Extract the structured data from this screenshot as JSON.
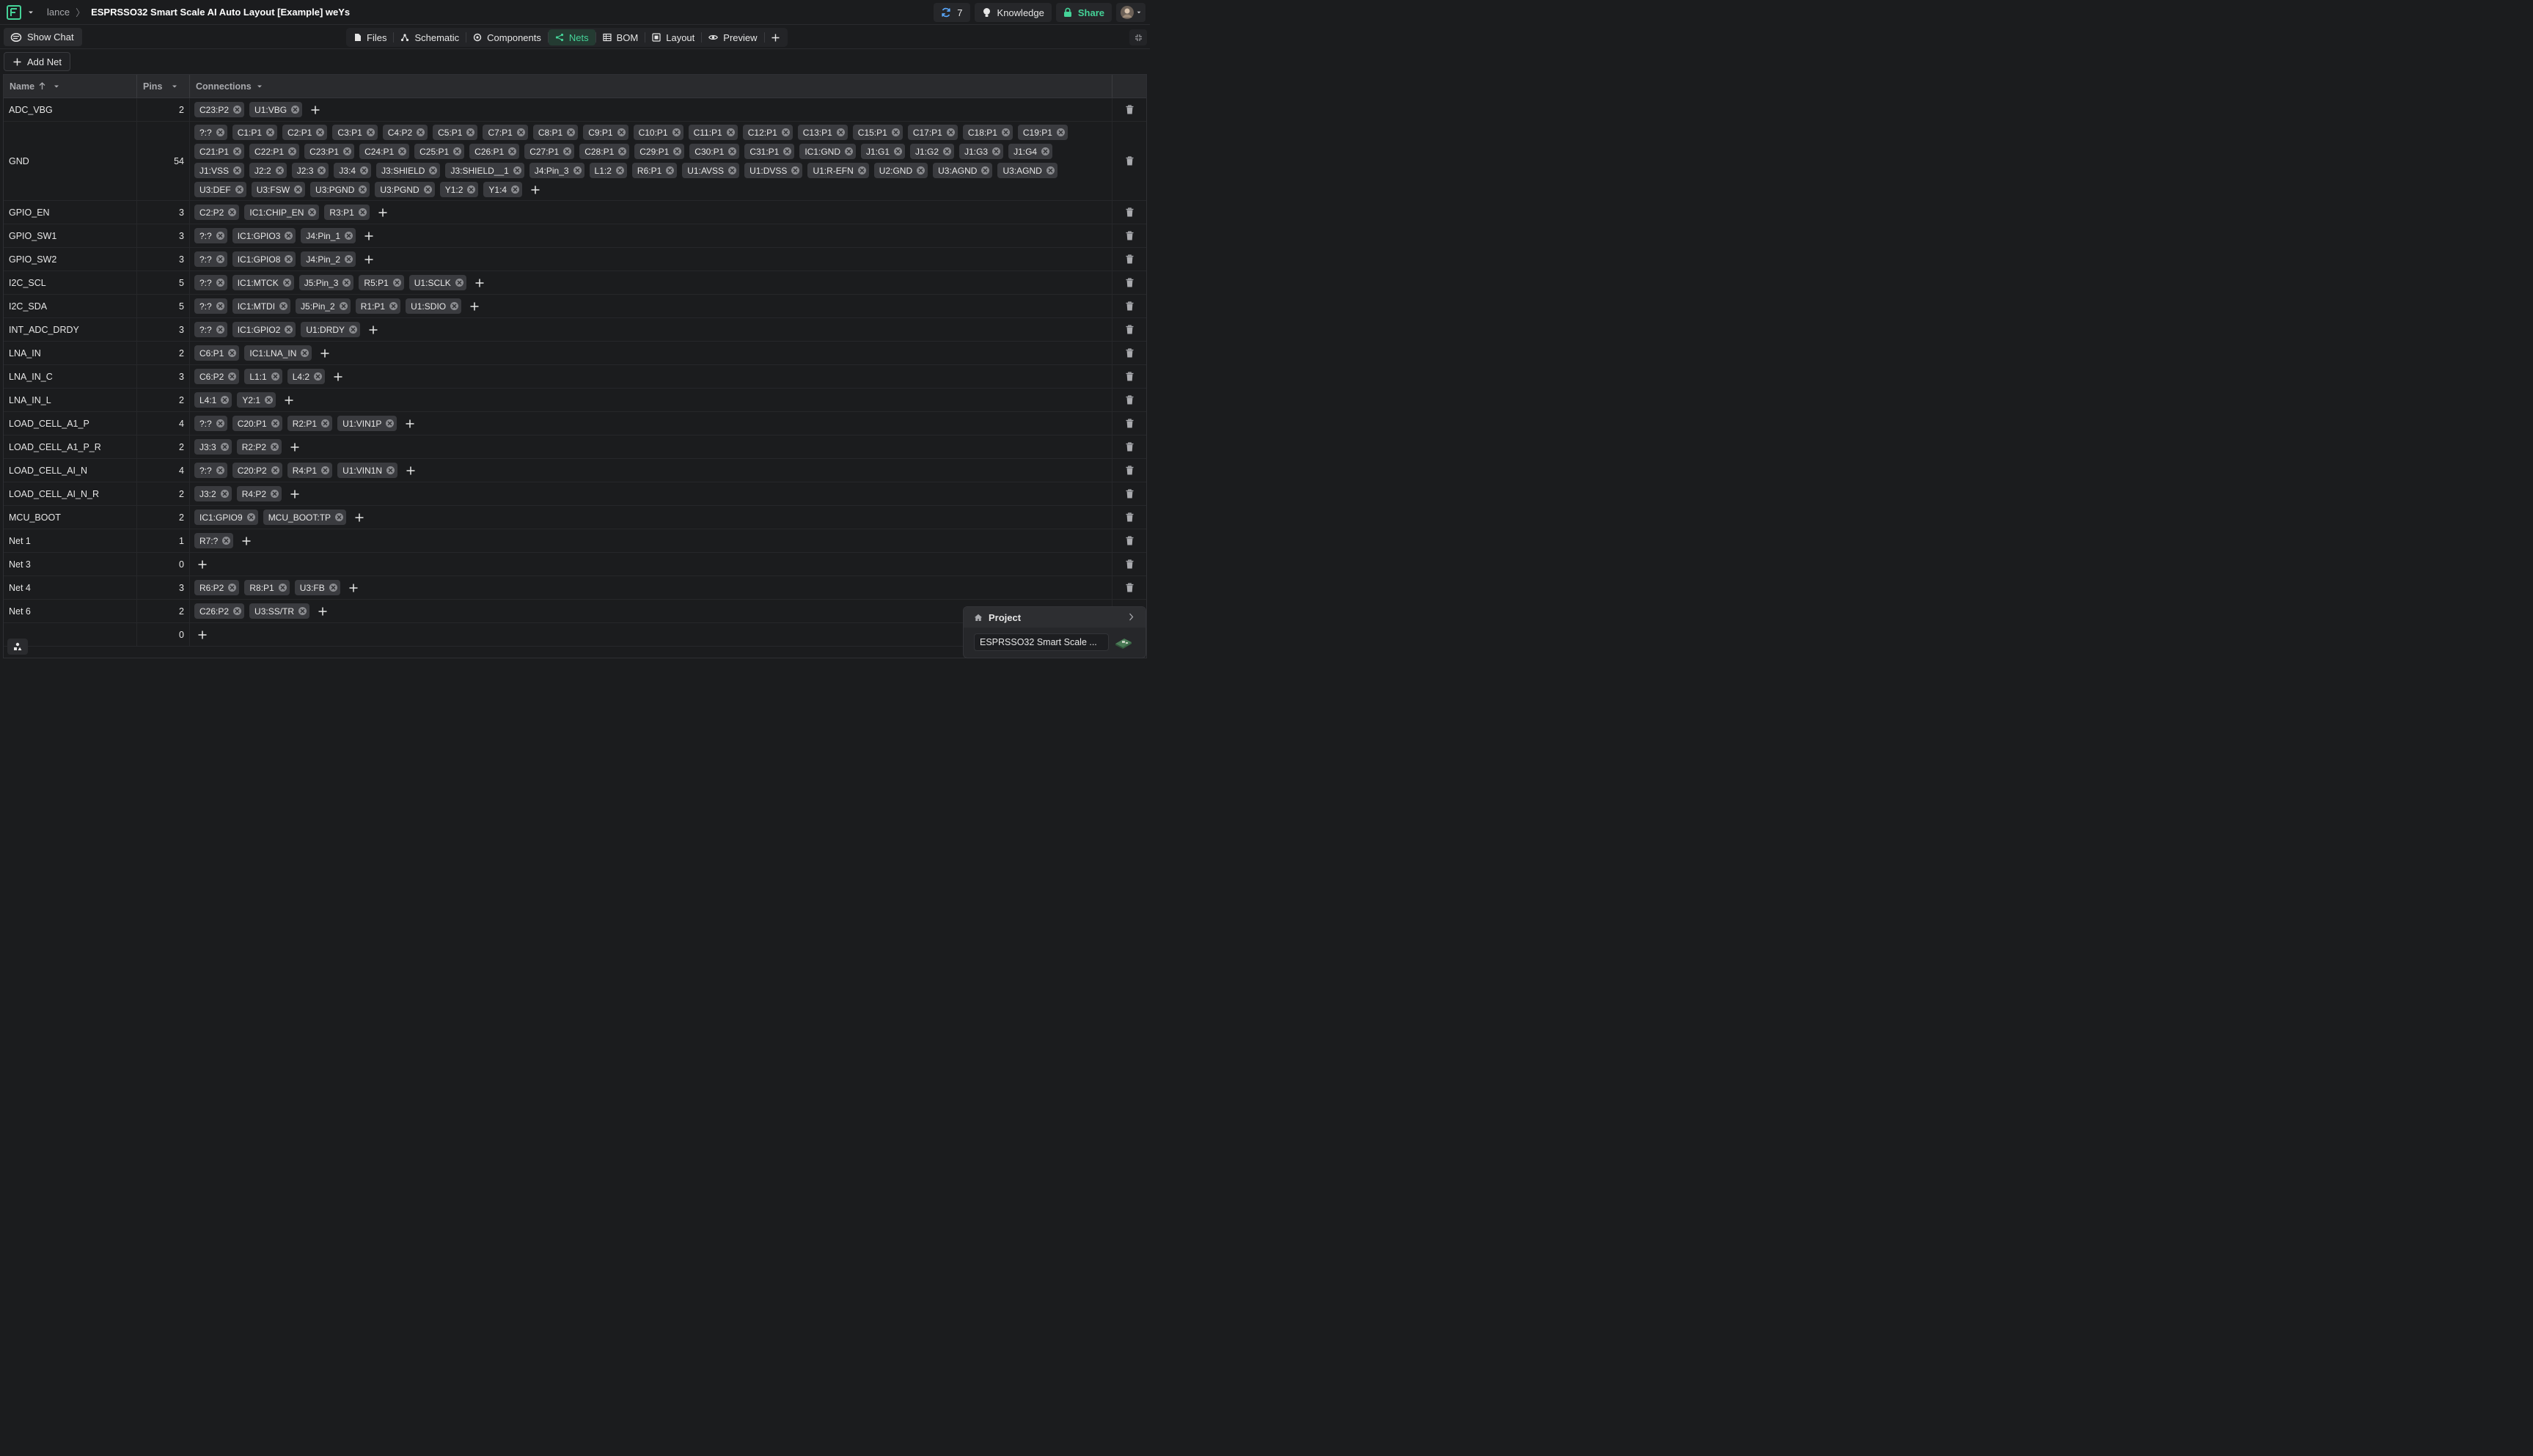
{
  "topbar": {
    "user": "lance",
    "separator": "〉",
    "title": "ESPRSSO32 Smart Scale AI Auto Layout [Example] weYs",
    "sync_count": "7",
    "knowledge_label": "Knowledge",
    "share_label": "Share"
  },
  "toolbar": {
    "show_chat_label": "Show Chat",
    "tabs": [
      {
        "label": "Files",
        "icon": "file-icon"
      },
      {
        "label": "Schematic",
        "icon": "schematic-icon"
      },
      {
        "label": "Components",
        "icon": "components-icon"
      },
      {
        "label": "Nets",
        "icon": "nets-icon"
      },
      {
        "label": "BOM",
        "icon": "bom-icon"
      },
      {
        "label": "Layout",
        "icon": "layout-icon"
      },
      {
        "label": "Preview",
        "icon": "eye-icon"
      }
    ],
    "active_tab": "Nets",
    "accent": "#45d398"
  },
  "add_net_label": "Add Net",
  "table": {
    "headers": {
      "name": "Name",
      "pins": "Pins",
      "connections": "Connections"
    },
    "rows": [
      {
        "name": "ADC_VBG",
        "pins": "2",
        "connections": [
          "C23:P2",
          "U1:VBG"
        ]
      },
      {
        "name": "GND",
        "pins": "54",
        "connections": [
          "?:?",
          "C1:P1",
          "C2:P1",
          "C3:P1",
          "C4:P2",
          "C5:P1",
          "C7:P1",
          "C8:P1",
          "C9:P1",
          "C10:P1",
          "C11:P1",
          "C12:P1",
          "C13:P1",
          "C15:P1",
          "C17:P1",
          "C18:P1",
          "C19:P1",
          "C21:P1",
          "C22:P1",
          "C23:P1",
          "C24:P1",
          "C25:P1",
          "C26:P1",
          "C27:P1",
          "C28:P1",
          "C29:P1",
          "C30:P1",
          "C31:P1",
          "IC1:GND",
          "J1:G1",
          "J1:G2",
          "J1:G3",
          "J1:G4",
          "J1:VSS",
          "J2:2",
          "J2:3",
          "J3:4",
          "J3:SHIELD",
          "J3:SHIELD__1",
          "J4:Pin_3",
          "L1:2",
          "R6:P1",
          "U1:AVSS",
          "U1:DVSS",
          "U1:R-EFN",
          "U2:GND",
          "U3:AGND",
          "U3:AGND",
          "U3:DEF",
          "U3:FSW",
          "U3:PGND",
          "U3:PGND",
          "Y1:2",
          "Y1:4"
        ]
      },
      {
        "name": "GPIO_EN",
        "pins": "3",
        "connections": [
          "C2:P2",
          "IC1:CHIP_EN",
          "R3:P1"
        ]
      },
      {
        "name": "GPIO_SW1",
        "pins": "3",
        "connections": [
          "?:?",
          "IC1:GPIO3",
          "J4:Pin_1"
        ]
      },
      {
        "name": "GPIO_SW2",
        "pins": "3",
        "connections": [
          "?:?",
          "IC1:GPIO8",
          "J4:Pin_2"
        ]
      },
      {
        "name": "I2C_SCL",
        "pins": "5",
        "connections": [
          "?:?",
          "IC1:MTCK",
          "J5:Pin_3",
          "R5:P1",
          "U1:SCLK"
        ]
      },
      {
        "name": "I2C_SDA",
        "pins": "5",
        "connections": [
          "?:?",
          "IC1:MTDI",
          "J5:Pin_2",
          "R1:P1",
          "U1:SDIO"
        ]
      },
      {
        "name": "INT_ADC_DRDY",
        "pins": "3",
        "connections": [
          "?:?",
          "IC1:GPIO2",
          "U1:DRDY"
        ]
      },
      {
        "name": "LNA_IN",
        "pins": "2",
        "connections": [
          "C6:P1",
          "IC1:LNA_IN"
        ]
      },
      {
        "name": "LNA_IN_C",
        "pins": "3",
        "connections": [
          "C6:P2",
          "L1:1",
          "L4:2"
        ]
      },
      {
        "name": "LNA_IN_L",
        "pins": "2",
        "connections": [
          "L4:1",
          "Y2:1"
        ]
      },
      {
        "name": "LOAD_CELL_A1_P",
        "pins": "4",
        "connections": [
          "?:?",
          "C20:P1",
          "R2:P1",
          "U1:VIN1P"
        ]
      },
      {
        "name": "LOAD_CELL_A1_P_R",
        "pins": "2",
        "connections": [
          "J3:3",
          "R2:P2"
        ]
      },
      {
        "name": "LOAD_CELL_AI_N",
        "pins": "4",
        "connections": [
          "?:?",
          "C20:P2",
          "R4:P1",
          "U1:VIN1N"
        ]
      },
      {
        "name": "LOAD_CELL_AI_N_R",
        "pins": "2",
        "connections": [
          "J3:2",
          "R4:P2"
        ]
      },
      {
        "name": "MCU_BOOT",
        "pins": "2",
        "connections": [
          "IC1:GPIO9",
          "MCU_BOOT:TP"
        ]
      },
      {
        "name": "Net 1",
        "pins": "1",
        "connections": [
          "R7:?"
        ]
      },
      {
        "name": "Net 3",
        "pins": "0",
        "connections": []
      },
      {
        "name": "Net 4",
        "pins": "3",
        "connections": [
          "R6:P2",
          "R8:P1",
          "U3:FB"
        ]
      },
      {
        "name": "Net 6",
        "pins": "2",
        "connections": [
          "C26:P2",
          "U3:SS/TR"
        ]
      },
      {
        "name": "",
        "pins": "0",
        "connections": []
      }
    ]
  },
  "project_panel": {
    "title": "Project",
    "project_name": "ESPRSSO32 Smart Scale ..."
  }
}
